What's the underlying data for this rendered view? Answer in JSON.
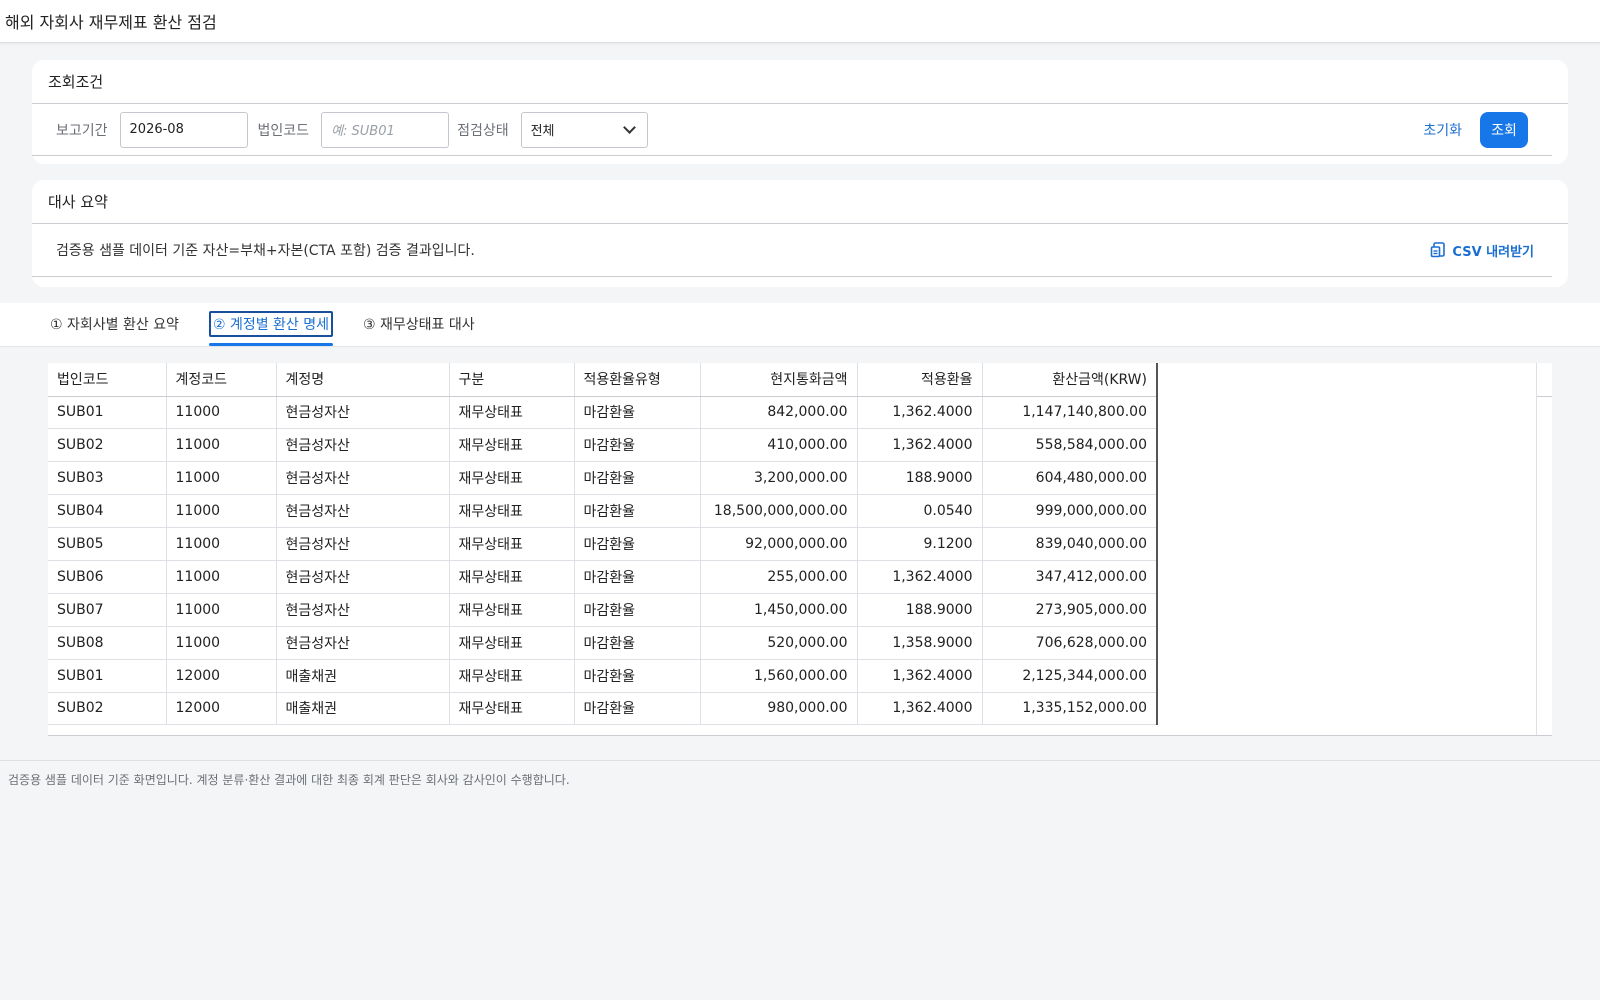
{
  "header": {
    "title": "해외 자회사 재무제표 환산 점검"
  },
  "conditions": {
    "title": "조회조건",
    "period_label": "보고기간",
    "period_value": "2026-08",
    "corp_label": "법인코드",
    "corp_placeholder": "예: SUB01",
    "status_label": "점검상태",
    "status_value": "전체",
    "reset_label": "초기화",
    "search_label": "조회"
  },
  "summary": {
    "title": "대사 요약",
    "text": "검증용 샘플 데이터 기준 자산=부채+자본(CTA 포함) 검증 결과입니다.",
    "csv_label": "CSV 내려받기"
  },
  "tabs": [
    {
      "label": "① 자회사별 환산 요약"
    },
    {
      "label": "② 계정별 환산 명세"
    },
    {
      "label": "③ 재무상태표 대사"
    }
  ],
  "table": {
    "columns": [
      "법인코드",
      "계정코드",
      "계정명",
      "구분",
      "적용환율유형",
      "현지통화금액",
      "적용환율",
      "환산금액(KRW)"
    ],
    "rows": [
      [
        "SUB01",
        "11000",
        "현금성자산",
        "재무상태표",
        "마감환율",
        "842,000.00",
        "1,362.4000",
        "1,147,140,800.00"
      ],
      [
        "SUB02",
        "11000",
        "현금성자산",
        "재무상태표",
        "마감환율",
        "410,000.00",
        "1,362.4000",
        "558,584,000.00"
      ],
      [
        "SUB03",
        "11000",
        "현금성자산",
        "재무상태표",
        "마감환율",
        "3,200,000.00",
        "188.9000",
        "604,480,000.00"
      ],
      [
        "SUB04",
        "11000",
        "현금성자산",
        "재무상태표",
        "마감환율",
        "18,500,000,000.00",
        "0.0540",
        "999,000,000.00"
      ],
      [
        "SUB05",
        "11000",
        "현금성자산",
        "재무상태표",
        "마감환율",
        "92,000,000.00",
        "9.1200",
        "839,040,000.00"
      ],
      [
        "SUB06",
        "11000",
        "현금성자산",
        "재무상태표",
        "마감환율",
        "255,000.00",
        "1,362.4000",
        "347,412,000.00"
      ],
      [
        "SUB07",
        "11000",
        "현금성자산",
        "재무상태표",
        "마감환율",
        "1,450,000.00",
        "188.9000",
        "273,905,000.00"
      ],
      [
        "SUB08",
        "11000",
        "현금성자산",
        "재무상태표",
        "마감환율",
        "520,000.00",
        "1,358.9000",
        "706,628,000.00"
      ],
      [
        "SUB01",
        "12000",
        "매출채권",
        "재무상태표",
        "마감환율",
        "1,560,000.00",
        "1,362.4000",
        "2,125,344,000.00"
      ],
      [
        "SUB02",
        "12000",
        "매출채권",
        "재무상태표",
        "마감환율",
        "980,000.00",
        "1,362.4000",
        "1,335,152,000.00"
      ]
    ]
  },
  "footer": {
    "text": "검증용 샘플 데이터 기준 화면입니다. 계정 분류·환산 결과에 대한 최종 회계 판단은 회사와 감사인이 수행합니다."
  }
}
